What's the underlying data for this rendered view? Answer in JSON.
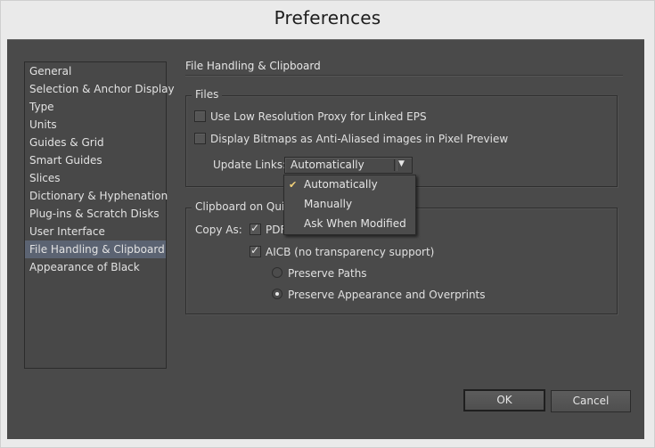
{
  "window": {
    "title": "Preferences"
  },
  "sidebar": {
    "items": [
      {
        "label": "General",
        "selected": false
      },
      {
        "label": "Selection & Anchor Display",
        "selected": false
      },
      {
        "label": "Type",
        "selected": false
      },
      {
        "label": "Units",
        "selected": false
      },
      {
        "label": "Guides & Grid",
        "selected": false
      },
      {
        "label": "Smart Guides",
        "selected": false
      },
      {
        "label": "Slices",
        "selected": false
      },
      {
        "label": "Dictionary & Hyphenation",
        "selected": false
      },
      {
        "label": "Plug-ins & Scratch Disks",
        "selected": false
      },
      {
        "label": "User Interface",
        "selected": false
      },
      {
        "label": "File Handling & Clipboard",
        "selected": true
      },
      {
        "label": "Appearance of Black",
        "selected": false
      }
    ]
  },
  "main": {
    "section_title": "File Handling & Clipboard",
    "files_group": {
      "legend": "Files",
      "use_low_res_proxy": {
        "label": "Use Low Resolution Proxy for Linked EPS",
        "checked": false
      },
      "display_bitmaps_antialiased": {
        "label": "Display Bitmaps as Anti-Aliased images in Pixel Preview",
        "checked": false
      },
      "update_links": {
        "label": "Update Links:",
        "value": "Automatically",
        "options": [
          {
            "label": "Automatically",
            "checked": true
          },
          {
            "label": "Manually",
            "checked": false
          },
          {
            "label": "Ask When Modified",
            "checked": false
          }
        ],
        "check_glyph": "✔",
        "check_color": "#f3d27a"
      }
    },
    "clipboard_group": {
      "legend": "Clipboard on Quit",
      "copy_as_label": "Copy As:",
      "pdf": {
        "label": "PDF",
        "checked": true
      },
      "aicb": {
        "label": "AICB (no transparency support)",
        "checked": true
      },
      "preserve_paths": {
        "label": "Preserve Paths",
        "selected": false
      },
      "preserve_appearance": {
        "label": "Preserve Appearance and Overprints",
        "selected": true
      }
    }
  },
  "buttons": {
    "ok": "OK",
    "cancel": "Cancel"
  },
  "icons": {
    "checkbox_tick": "✓",
    "dropdown_arrow": "▼"
  }
}
